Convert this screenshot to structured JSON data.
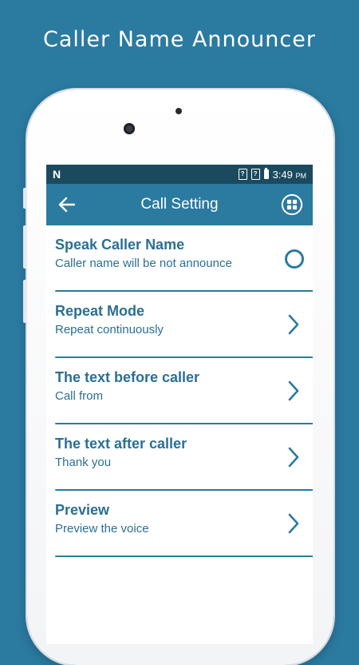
{
  "promo": {
    "title": "Caller Name Announcer"
  },
  "status_bar": {
    "notification_letter": "N",
    "time": "3:49",
    "ampm": "PM"
  },
  "app_bar": {
    "title": "Call Setting"
  },
  "settings": [
    {
      "title": "Speak Caller Name",
      "subtitle": "Caller name will be not announce",
      "control": "toggle"
    },
    {
      "title": "Repeat Mode",
      "subtitle": "Repeat continuously",
      "control": "chevron"
    },
    {
      "title": "The text before caller",
      "subtitle": "Call from",
      "control": "chevron"
    },
    {
      "title": "The text after caller",
      "subtitle": "Thank you",
      "control": "chevron"
    },
    {
      "title": "Preview",
      "subtitle": "Preview the voice",
      "control": "chevron"
    }
  ],
  "colors": {
    "accent": "#2b7aa0",
    "status_bar": "#1b4a5e",
    "text": "#2b6f93",
    "background": "#ffffff"
  }
}
